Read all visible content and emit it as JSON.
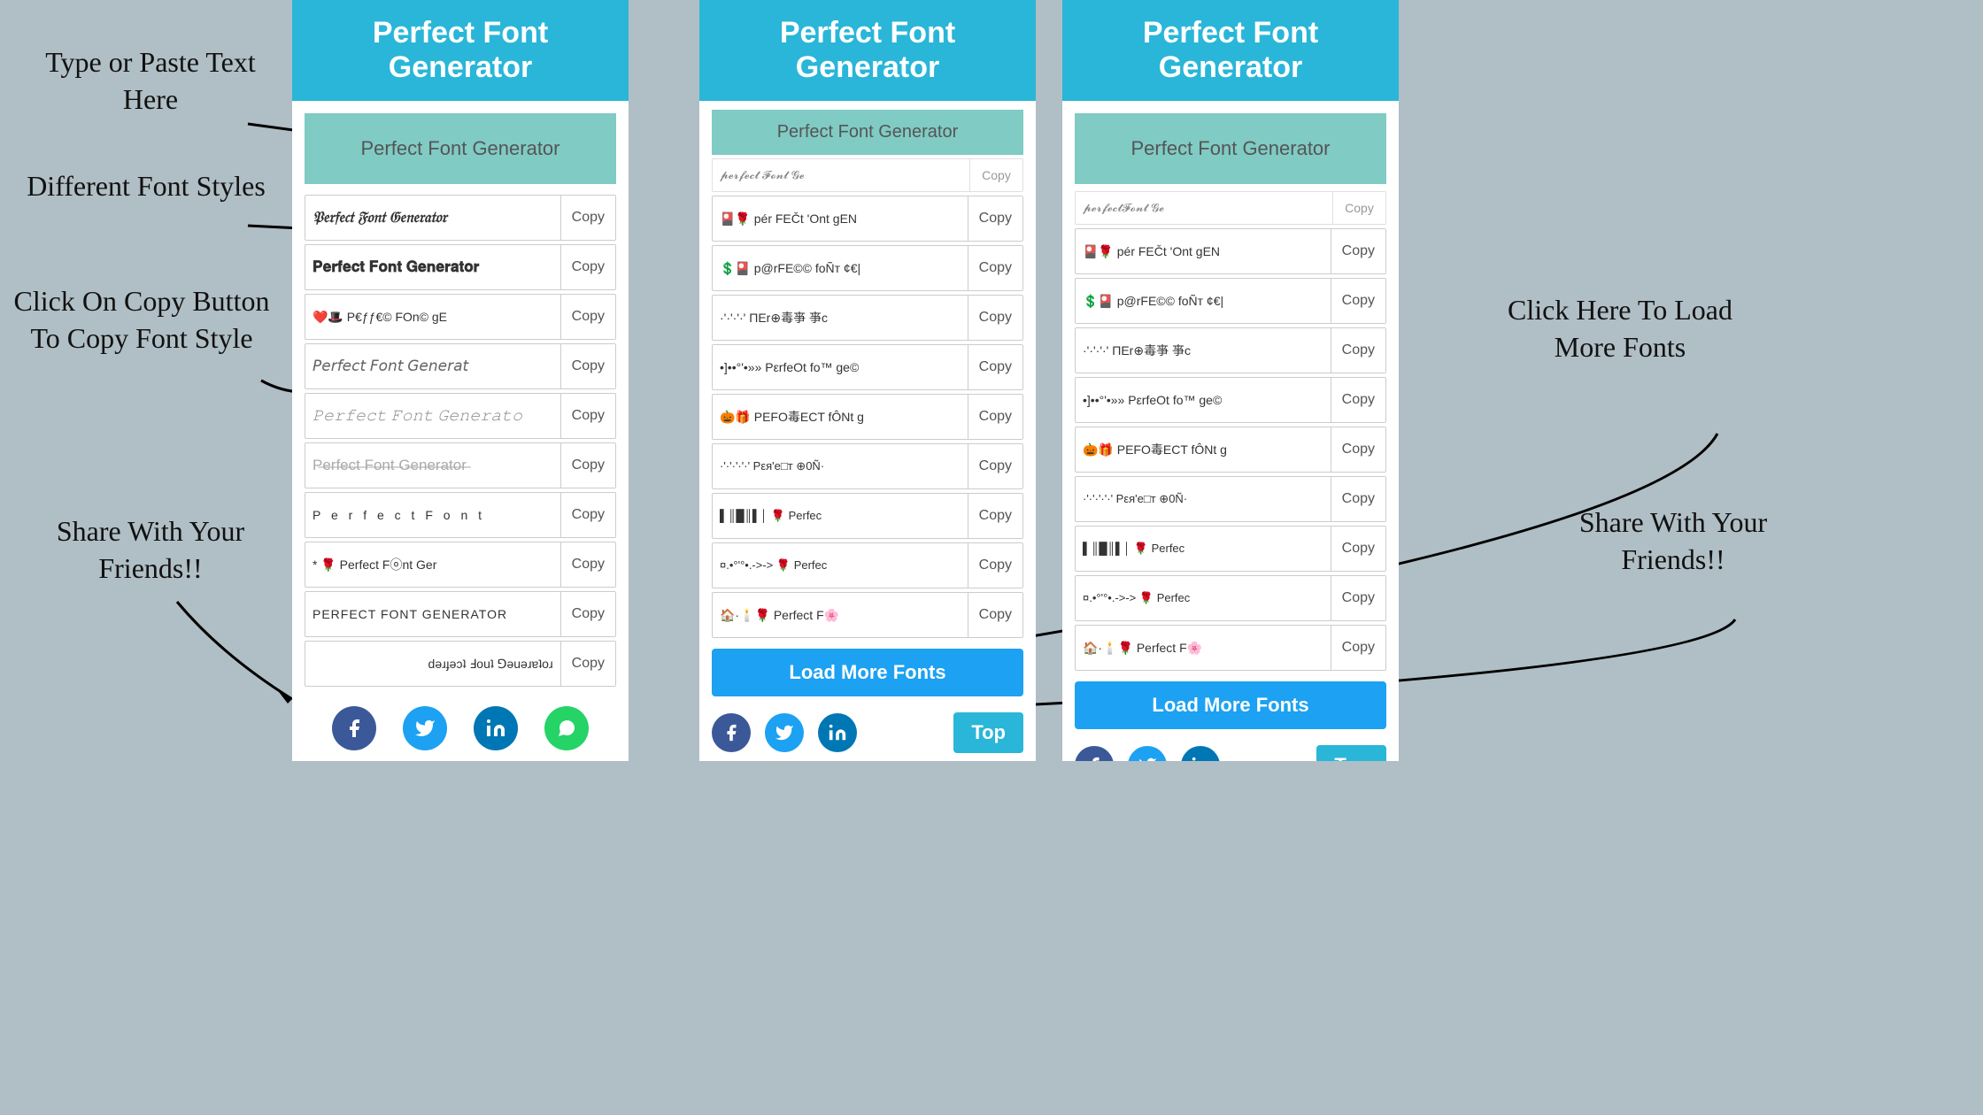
{
  "app": {
    "title": "Perfect Font Generator",
    "header": "Perfect Font Generator"
  },
  "annotations": {
    "type_paste": "Type or Paste Text\nHere",
    "different_fonts": "Different Font\nStyles",
    "click_copy": "Click On Copy\nButton To Copy\nFont Style",
    "share": "Share With\nYour\nFriends!!",
    "click_load": "Click Here To\nLoad More\nFonts",
    "share_right": "Share With\nYour\nFriends!!"
  },
  "input": {
    "value": "Perfect Font Generator",
    "placeholder": "Type or Paste Text Here"
  },
  "left_panel": {
    "title": "Perfect Font Generator",
    "fonts": [
      {
        "text": "𝔓𝔢𝔯𝔣𝔢𝔠𝔱 𝔉𝔬𝔫𝔱 𝔊𝔢𝔫𝔢𝔯𝔞𝔱𝔬𝔯",
        "style": "fraktur"
      },
      {
        "text": "𝐏𝐞𝐫𝐟𝐞𝐜𝐭 𝐅𝐨𝐧𝐭 𝐆𝐞𝐧𝐞𝐫𝐚𝐭𝐨𝐫",
        "style": "bold"
      },
      {
        "text": "❤️🎩 P€ƒƒ€© FOn© gE",
        "style": "emoji"
      },
      {
        "text": "𝘗𝘦𝘳𝘧𝘦𝘤𝘵 𝘍𝘰𝘯𝘵 𝘎𝘦𝘯𝘦𝘳𝘢𝘵",
        "style": "italic"
      },
      {
        "text": "𝙿𝚎𝚛𝚏𝚎𝚌𝚝 𝙵𝚘𝚗𝚝 𝙶𝚎𝚗𝚎𝚛𝚊𝚝𝚘",
        "style": "mono"
      },
      {
        "text": "Perfect Fo̶n̶t̶ Generator",
        "style": "strike"
      },
      {
        "text": "P  e  r  f  e  c  t   F  o  n  t",
        "style": "spaced"
      },
      {
        "text": "* 🌹 Perfect Fⓞnt Ger",
        "style": "emoji2"
      },
      {
        "text": "PERFECT FONT GENERATOR",
        "style": "caps"
      },
      {
        "text": "ɹoʇɐɹǝuǝ⅁ ʇuoℲ ʇɔǝɟɹǝd",
        "style": "flipped"
      }
    ],
    "copy_label": "Copy"
  },
  "right_panel": {
    "title": "Perfect Font Generator",
    "input_value": "Perfect Font Generator",
    "partial_top": "𝓹𝓮𝓻𝓯𝓮𝓬𝓽 𝓕𝓸𝓷𝓽 𝓖𝓮",
    "fonts": [
      {
        "text": "🎴🌹 pér FEČt 'Ont gEN",
        "style": "emoji"
      },
      {
        "text": "💲🎴 p@rFE©© foÑr ¢€|",
        "style": "emoji"
      },
      {
        "text": "·'·'·'·' ΠEr⊕毒亊 亊c",
        "style": "special"
      },
      {
        "text": "•]••°'•»» PεrfeOt fo™ ge©",
        "style": "special"
      },
      {
        "text": "🎃🎁 PEFО毒ECT fÔNt g",
        "style": "emoji"
      },
      {
        "text": "·'·'·'·'·' Pεя'e□т ⊕0Ñ·",
        "style": "special"
      },
      {
        "text": "▌║█║▌│ 🌹 Perfec",
        "style": "bar"
      },
      {
        "text": "¤.•°'°•.->-> 🌹 Perfec",
        "style": "special"
      },
      {
        "text": "🏠·🕯️🌹 Perfect F🌸",
        "style": "emoji"
      }
    ],
    "load_more_label": "Load More Fonts",
    "top_label": "Top",
    "copy_label": "Copy"
  },
  "social": {
    "facebook": "f",
    "twitter": "🐦",
    "linkedin": "in",
    "whatsapp": "✆"
  },
  "colors": {
    "header_bg": "#29b6d8",
    "input_bg": "#80cbc4",
    "load_more_bg": "#1da1f2",
    "top_bg": "#29b6d8",
    "facebook": "#3b5998",
    "twitter": "#1da1f2",
    "linkedin": "#0077b5",
    "whatsapp": "#25d366"
  }
}
